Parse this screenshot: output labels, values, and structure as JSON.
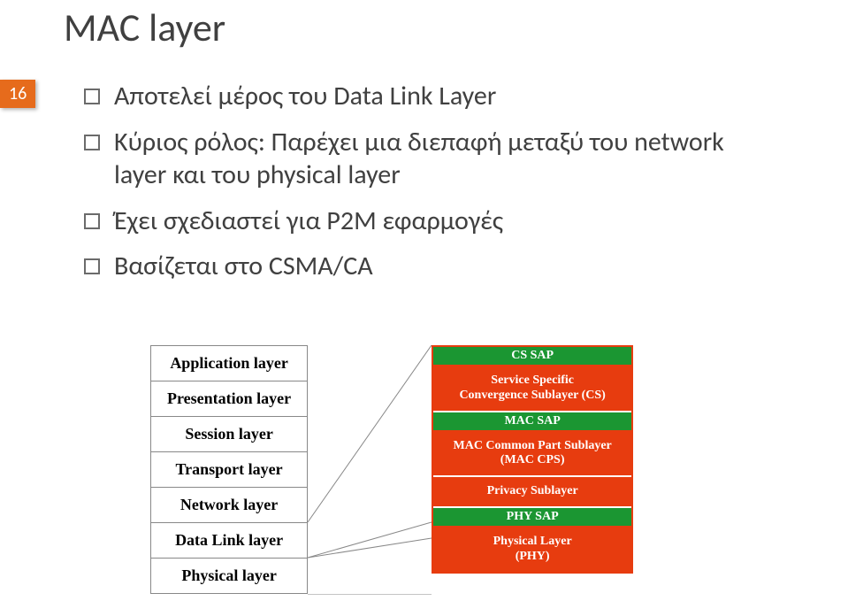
{
  "slide_number": "16",
  "title": "MAC layer",
  "bullets": [
    "Αποτελεί μέρος του Data Link Layer",
    "Κύριος ρόλος: Παρέχει μια διεπαφή μεταξύ του network layer και του physical layer",
    "Έχει σχεδιαστεί για P2M εφαρμογές",
    "Βασίζεται στο CSMA/CA"
  ],
  "osi_left": {
    "rows": [
      {
        "label": "Application layer",
        "bold": true
      },
      {
        "label": "Presentation layer",
        "bold": true
      },
      {
        "label": "Session layer",
        "bold": true
      },
      {
        "label": "Transport layer",
        "bold": true
      },
      {
        "label": "Network layer",
        "bold": true
      },
      {
        "label": "Data Link layer",
        "bold": true
      },
      {
        "label": "Physical layer",
        "bold": true
      }
    ]
  },
  "right_stack": [
    {
      "type": "sap",
      "label": "CS SAP"
    },
    {
      "type": "sub",
      "label": "Service Specific\nConvergence Sublayer (CS)"
    },
    {
      "type": "sap",
      "label": "MAC SAP"
    },
    {
      "type": "sub",
      "label": "MAC Common Part Sublayer\n(MAC CPS)"
    },
    {
      "type": "sub",
      "label": "Privacy Sublayer"
    },
    {
      "type": "sap",
      "label": "PHY SAP"
    },
    {
      "type": "sub",
      "label": "Physical Layer\n(PHY)",
      "last": true
    }
  ],
  "colors": {
    "accent": "#e66b1c",
    "green": "#1b9632",
    "red": "#e73c0f"
  }
}
